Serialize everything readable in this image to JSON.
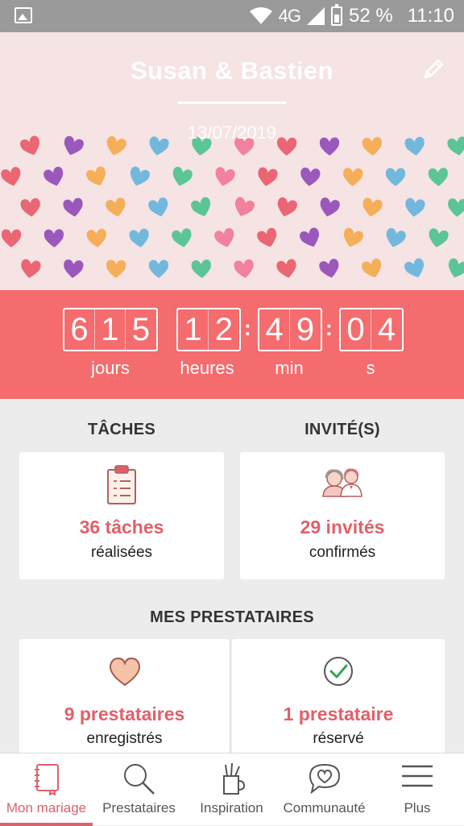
{
  "status_bar": {
    "network": "4G",
    "network_sup": "4G",
    "battery": "52 %",
    "time": "11:10"
  },
  "header": {
    "couple": "Susan & Bastien",
    "date": "13/07/2019"
  },
  "countdown": {
    "days_digits": [
      "6",
      "1",
      "5"
    ],
    "days_label": "jours",
    "hours_digits": [
      "1",
      "2"
    ],
    "hours_label": "heures",
    "min_digits": [
      "4",
      "9"
    ],
    "min_label": "min",
    "sec_digits": [
      "0",
      "4"
    ],
    "sec_label": "s",
    "sep": ":"
  },
  "tasks": {
    "title": "TÂCHES",
    "count": "36 tâches",
    "sub": "réalisées",
    "icon": "clipboard-icon"
  },
  "guests": {
    "title": "INVITÉ(S)",
    "count": "29 invités",
    "sub": "confirmés",
    "icon": "couple-icon"
  },
  "vendors": {
    "title": "MES PRESTATAIRES",
    "saved": {
      "count": "9 prestataires",
      "sub": "enregistrés",
      "icon": "heart-icon"
    },
    "booked": {
      "count": "1 prestataire",
      "sub": "réservé",
      "icon": "check-circle-icon"
    }
  },
  "nav": [
    {
      "label": "Mon mariage",
      "icon": "notebook-icon",
      "active": true
    },
    {
      "label": "Prestataires",
      "icon": "search-icon"
    },
    {
      "label": "Inspiration",
      "icon": "pencil-cup-icon"
    },
    {
      "label": "Communauté",
      "icon": "chat-heart-icon"
    },
    {
      "label": "Plus",
      "icon": "menu-icon"
    }
  ],
  "colors": {
    "accent": "#f46c6e",
    "accent_text": "#e0606a",
    "header_bg": "#f6e3e4",
    "status_bg": "#9a9a9a"
  }
}
